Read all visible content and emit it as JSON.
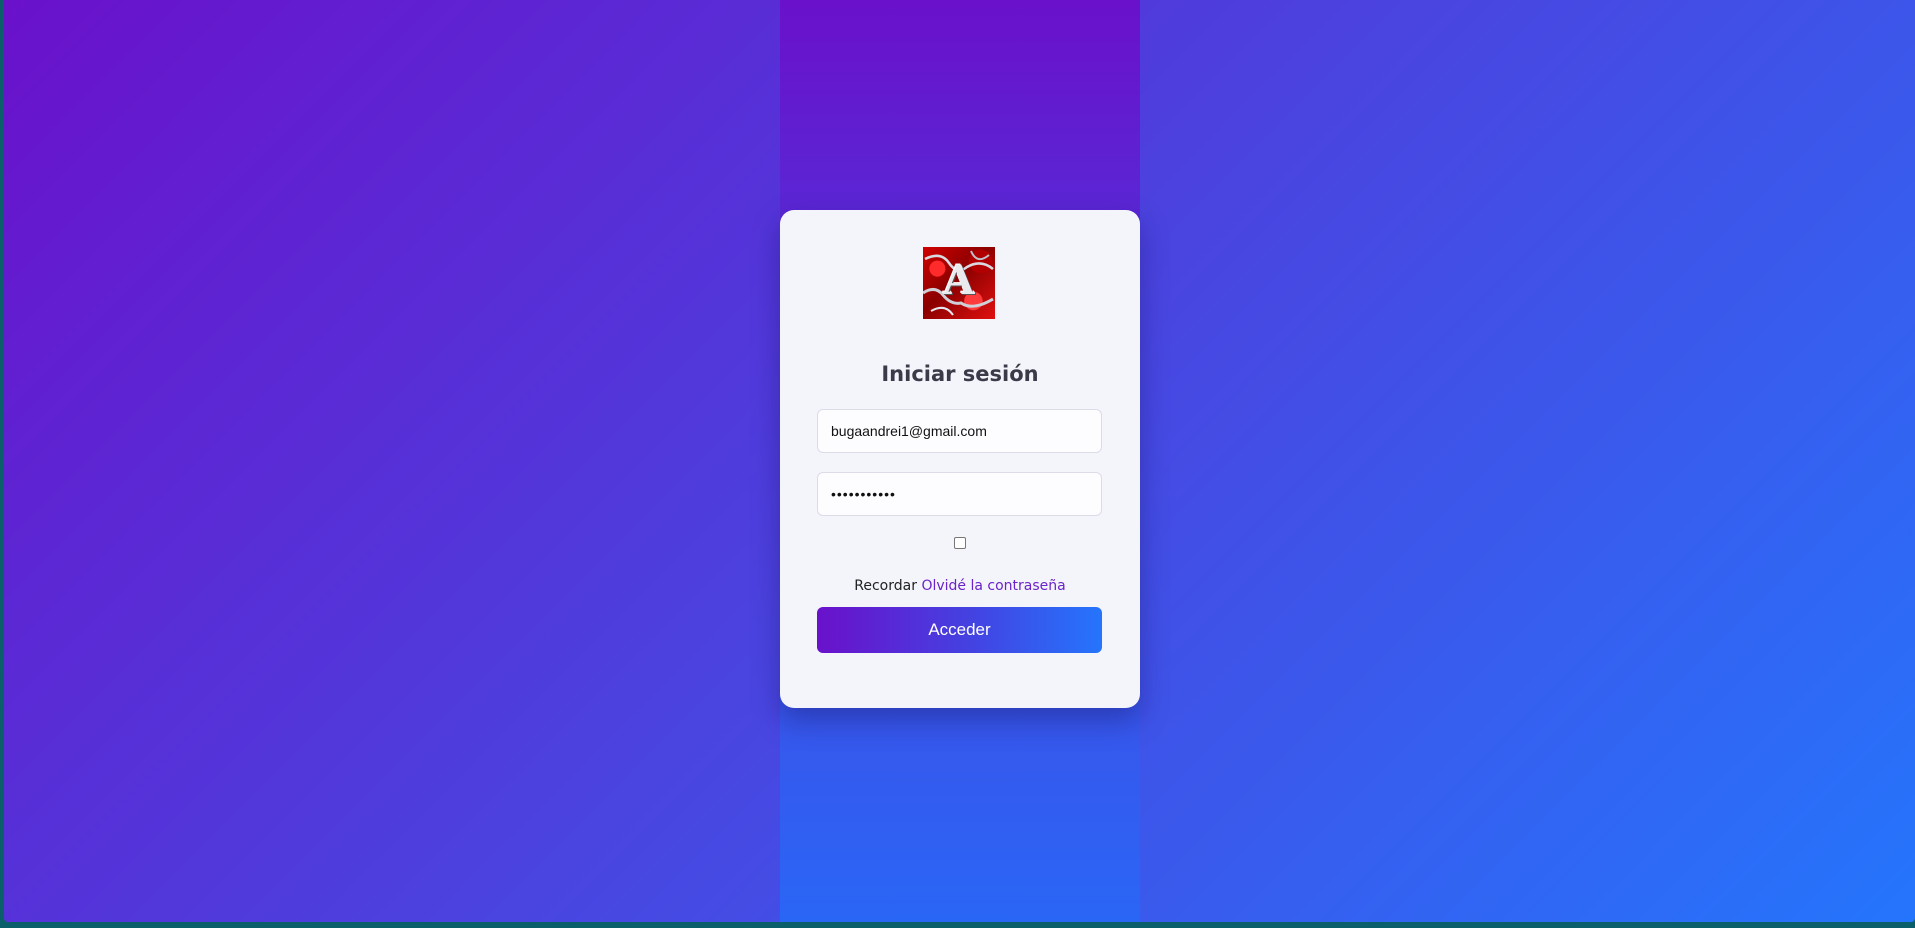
{
  "login": {
    "logo_icon": "red-marble-A-logo",
    "logo_letter": "A",
    "title": "Iniciar sesión",
    "email_value": "bugaandrei1@gmail.com",
    "password_value": "•••••••••••",
    "remember_label": "Recordar",
    "forgot_label": "Olvidé la contraseña",
    "submit_label": "Acceder"
  },
  "colors": {
    "gradient_start": "#6a11cb",
    "gradient_end": "#2575fc",
    "link": "#6a24c8"
  }
}
